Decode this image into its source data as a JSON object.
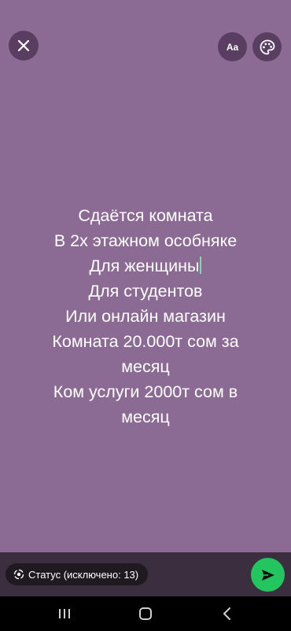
{
  "header": {
    "close_icon": "close-icon",
    "font_button_label": "Aa",
    "palette_icon": "palette-icon"
  },
  "status": {
    "background_color": "#8b6b94",
    "lines": [
      "Сдаётся комната",
      "В 2х этажном особняке",
      "Для женщины",
      "Для студентов",
      "Или онлайн магазин",
      "Комната 20.000т сом за",
      "месяц",
      "Ком услуги 2000т сом в",
      "месяц"
    ]
  },
  "footer": {
    "audience_label": "Статус (исключено: 13)",
    "audience_icon": "status-ring-icon",
    "send_icon": "send-icon",
    "send_color": "#22c55e"
  },
  "nav": {
    "recents_icon": "recents-icon",
    "home_icon": "home-icon",
    "back_icon": "back-icon"
  }
}
